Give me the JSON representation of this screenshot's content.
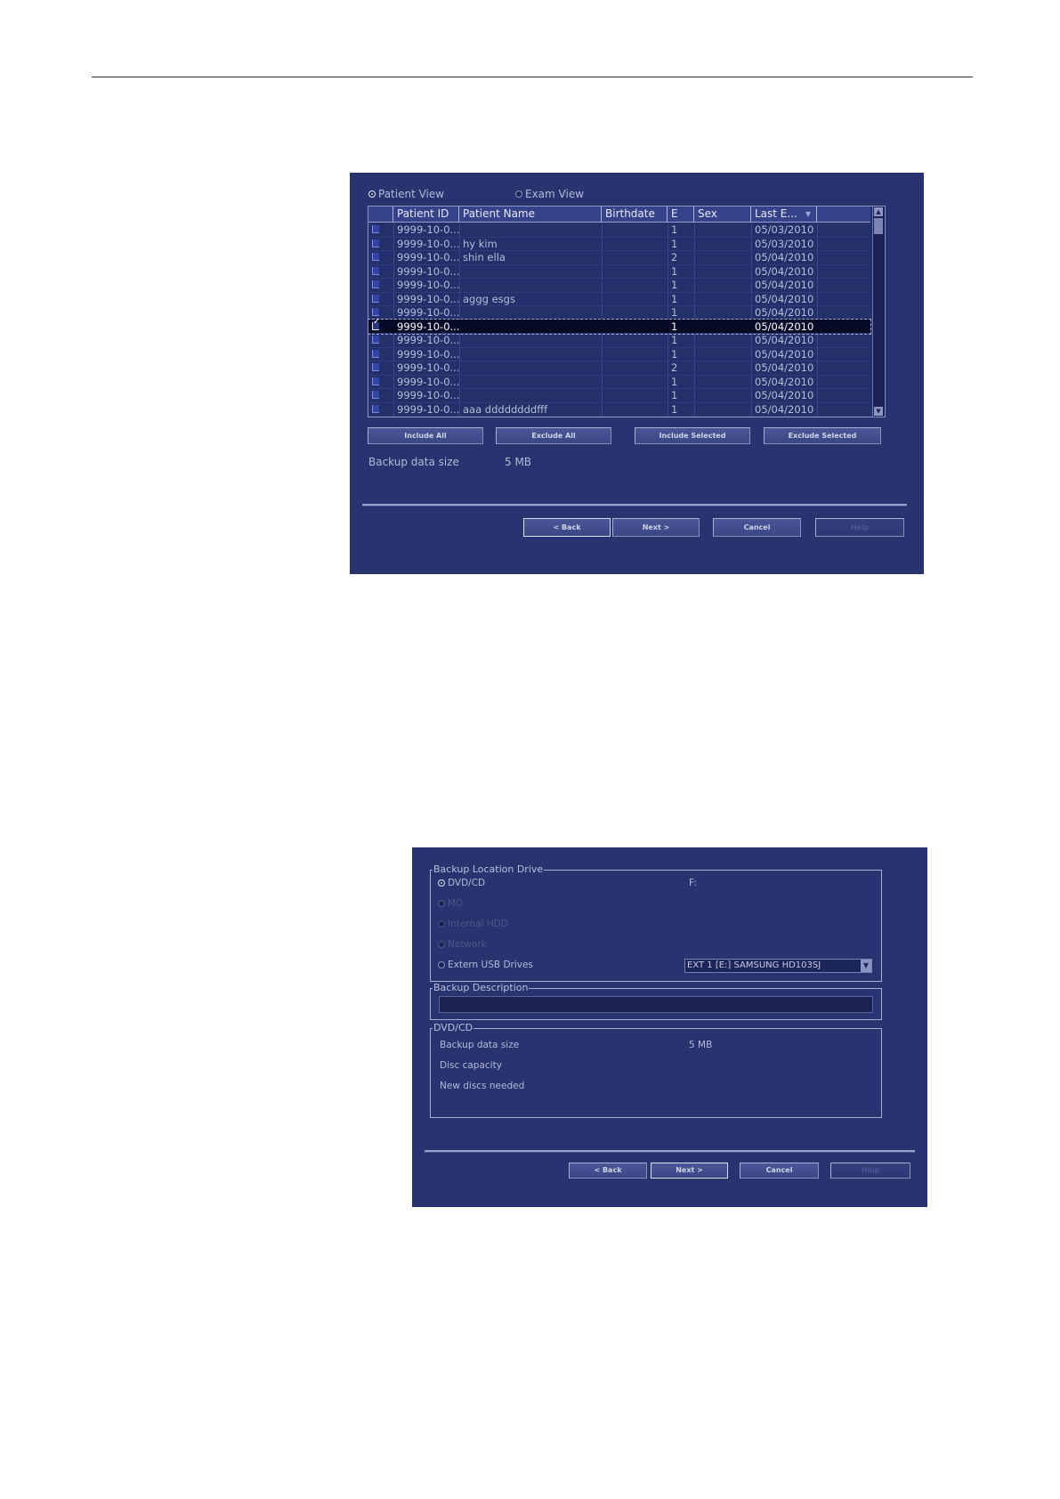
{
  "panel1": {
    "view_options": {
      "patient_view": "Patient View",
      "exam_view": "Exam View"
    },
    "columns": [
      "Patient ID",
      "Patient Name",
      "Birthdate",
      "E",
      "Sex",
      "Last E..."
    ],
    "rows": [
      {
        "id": "9999-10-0...",
        "name": "",
        "birthdate": "",
        "e": "1",
        "sex": "",
        "last": "05/03/2010",
        "checked": false
      },
      {
        "id": "9999-10-0...",
        "name": "hy kim",
        "birthdate": "",
        "e": "1",
        "sex": "",
        "last": "05/03/2010",
        "checked": false
      },
      {
        "id": "9999-10-0...",
        "name": "shin ella",
        "birthdate": "",
        "e": "2",
        "sex": "",
        "last": "05/04/2010",
        "checked": false
      },
      {
        "id": "9999-10-0...",
        "name": "",
        "birthdate": "",
        "e": "1",
        "sex": "",
        "last": "05/04/2010",
        "checked": false
      },
      {
        "id": "9999-10-0...",
        "name": "",
        "birthdate": "",
        "e": "1",
        "sex": "",
        "last": "05/04/2010",
        "checked": false
      },
      {
        "id": "9999-10-0...",
        "name": "aggg esgs",
        "birthdate": "",
        "e": "1",
        "sex": "",
        "last": "05/04/2010",
        "checked": false
      },
      {
        "id": "9999-10-0...",
        "name": "",
        "birthdate": "",
        "e": "1",
        "sex": "",
        "last": "05/04/2010",
        "checked": false
      },
      {
        "id": "9999-10-0...",
        "name": "",
        "birthdate": "",
        "e": "1",
        "sex": "",
        "last": "05/04/2010",
        "checked": true
      },
      {
        "id": "9999-10-0...",
        "name": "",
        "birthdate": "",
        "e": "1",
        "sex": "",
        "last": "05/04/2010",
        "checked": false
      },
      {
        "id": "9999-10-0...",
        "name": "",
        "birthdate": "",
        "e": "1",
        "sex": "",
        "last": "05/04/2010",
        "checked": false
      },
      {
        "id": "9999-10-0...",
        "name": "",
        "birthdate": "",
        "e": "2",
        "sex": "",
        "last": "05/04/2010",
        "checked": false
      },
      {
        "id": "9999-10-0...",
        "name": "",
        "birthdate": "",
        "e": "1",
        "sex": "",
        "last": "05/04/2010",
        "checked": false
      },
      {
        "id": "9999-10-0...",
        "name": "",
        "birthdate": "",
        "e": "1",
        "sex": "",
        "last": "05/04/2010",
        "checked": false
      },
      {
        "id": "9999-10-0...",
        "name": "aaa ddddddddfff",
        "birthdate": "",
        "e": "1",
        "sex": "",
        "last": "05/04/2010",
        "checked": false
      }
    ],
    "selected_row": 7,
    "buttons": {
      "include_all": "Include All",
      "exclude_all": "Exclude All",
      "include_selected": "Include Selected",
      "exclude_selected": "Exclude Selected"
    },
    "backup_size_label": "Backup data size",
    "backup_size_value": "5 MB",
    "nav": {
      "back": "< Back",
      "next": "Next >",
      "cancel": "Cancel",
      "help": "Help"
    }
  },
  "panel2": {
    "location_group": "Backup Location Drive",
    "locations": [
      {
        "label": "DVD/CD",
        "enabled": true,
        "selected": true
      },
      {
        "label": "MO",
        "enabled": false,
        "selected": false
      },
      {
        "label": "Internal HDD",
        "enabled": false,
        "selected": false
      },
      {
        "label": "Network",
        "enabled": false,
        "selected": false
      },
      {
        "label": "Extern USB Drives",
        "enabled": true,
        "selected": false
      }
    ],
    "drive_letter": "F:",
    "usb_drive_value": "EXT 1 [E:] SAMSUNG HD103SJ",
    "description_group": "Backup Description",
    "description_value": "",
    "media_group": "DVD/CD",
    "info_labels": {
      "size": "Backup data size",
      "capacity": "Disc capacity",
      "discs": "New discs needed"
    },
    "size_value": "5 MB",
    "nav": {
      "back": "< Back",
      "next": "Next >",
      "cancel": "Cancel",
      "help": "Help"
    }
  },
  "colors": {
    "panel_bg": "#28336f",
    "selected_row": "#060a26",
    "header_bg": "#36438a"
  }
}
